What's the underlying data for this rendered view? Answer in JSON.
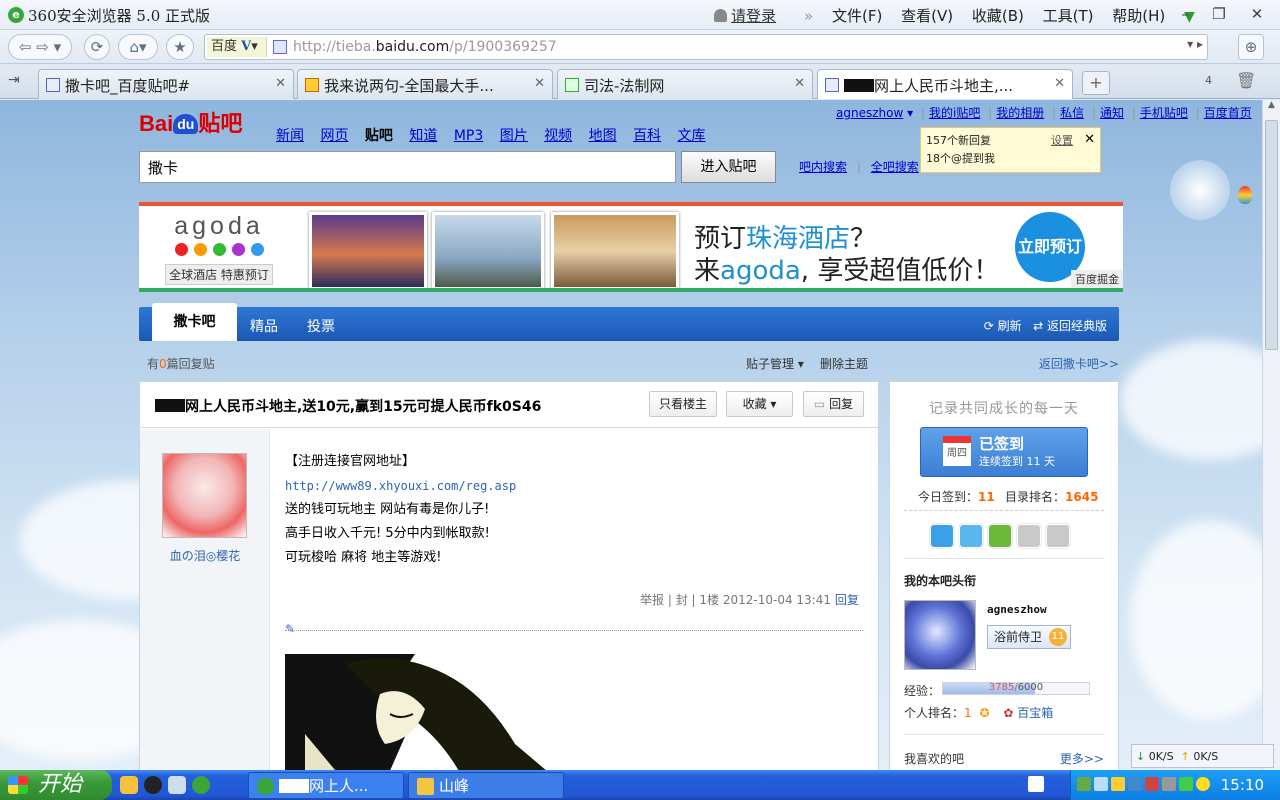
{
  "browser": {
    "title": "360安全浏览器 5.0 正式版",
    "login": "请登录",
    "menus": [
      "文件(F)",
      "查看(V)",
      "收藏(B)",
      "工具(T)",
      "帮助(H)"
    ],
    "search_engine": "百度",
    "url_prefix": "http://tieba.",
    "url_domain": "baidu.com",
    "url_path": "/p/1900369257",
    "tabs": [
      {
        "label": "撒卡吧_百度贴吧#",
        "active": false
      },
      {
        "label": "我来说两句-全国最大手...",
        "active": false
      },
      {
        "label": "司法-法制网",
        "active": false
      },
      {
        "label": "网上人民币斗地主,...",
        "active": true
      }
    ],
    "tab_count": "4"
  },
  "baidu": {
    "logo_bai": "Bai",
    "logo_du": "du",
    "logo_tieba": "贴吧",
    "nav": [
      "新闻",
      "网页",
      "贴吧",
      "知道",
      "MP3",
      "图片",
      "视频",
      "地图",
      "百科",
      "文库"
    ],
    "nav_current": "贴吧",
    "search_value": "撒卡",
    "search_button": "进入贴吧",
    "search_in_forum": "吧内搜索",
    "search_all": "全吧搜索",
    "user": "agneszhow",
    "user_links": [
      "我的i贴吧",
      "我的相册",
      "私信",
      "通知",
      "手机贴吧",
      "百度首页"
    ],
    "notice": {
      "line1": "157个新回复",
      "line2": "18个@提到我",
      "settings": "设置"
    }
  },
  "banner": {
    "brand": "agoda",
    "tag": "全球酒店 特惠预订",
    "promo_line1_a": "预订",
    "promo_line1_b": "珠海酒店",
    "promo_line1_c": "？",
    "promo_line2_a": "来",
    "promo_line2_b": "agoda",
    "promo_line2_c": ", 享受超值低价！",
    "book_button": "立即预订",
    "ad_label": "百度掘金"
  },
  "forum": {
    "tabs": [
      "撒卡吧",
      "精品",
      "投票"
    ],
    "refresh": "刷新",
    "classic": "返回经典版",
    "reply_count_prefix": "有",
    "reply_count": "0",
    "reply_count_suffix": "篇回复贴",
    "manage": "贴子管理",
    "delete": "删除主题",
    "back": "返回撒卡吧>>"
  },
  "thread": {
    "title": "网上人民币斗地主,送10元,赢到15元可提人民币fk0S46",
    "only_op": "只看楼主",
    "favorite": "收藏",
    "reply": "回复",
    "author": "血の泪◎樱花",
    "lines": [
      "【注册连接官网地址】",
      "http://www89.xhyouxi.com/reg.asp",
      "送的钱可玩地主 网站有毒是你儿子!",
      "高手日收入千元!  5分中内到帐取款!",
      "可玩梭哈 麻将 地主等游戏!"
    ],
    "meta_report": "举报",
    "meta_ban": "封",
    "meta_floor": "1楼",
    "meta_time": "2012-10-04 13:41",
    "meta_reply": "回复"
  },
  "sidebar": {
    "slogan": "记录共同成长的每一天",
    "sign_weekday": "周四",
    "sign_status": "已签到",
    "sign_streak": "连续签到 11 天",
    "today_sign_label": "今日签到：",
    "today_sign_value": "11",
    "rank_label": "目录排名：",
    "rank_value": "1645",
    "my_head_title": "我的本吧头衔",
    "my_name": "agneszhow",
    "my_title": "浴前侍卫",
    "my_level": "11",
    "exp_label": "经验：",
    "exp_current": "3785",
    "exp_total": "6000",
    "exp_progress": 0.63,
    "personal_rank_label": "个人排名：",
    "personal_rank_value": "1",
    "treasure": "百宝箱",
    "fav_forums": "我喜欢的吧",
    "more": "更多>>"
  },
  "speed": {
    "down": "0K/S",
    "up": "0K/S"
  },
  "taskbar": {
    "start": "开始",
    "tasks": [
      "网上人...",
      "山峰"
    ],
    "clock": "15:10"
  }
}
